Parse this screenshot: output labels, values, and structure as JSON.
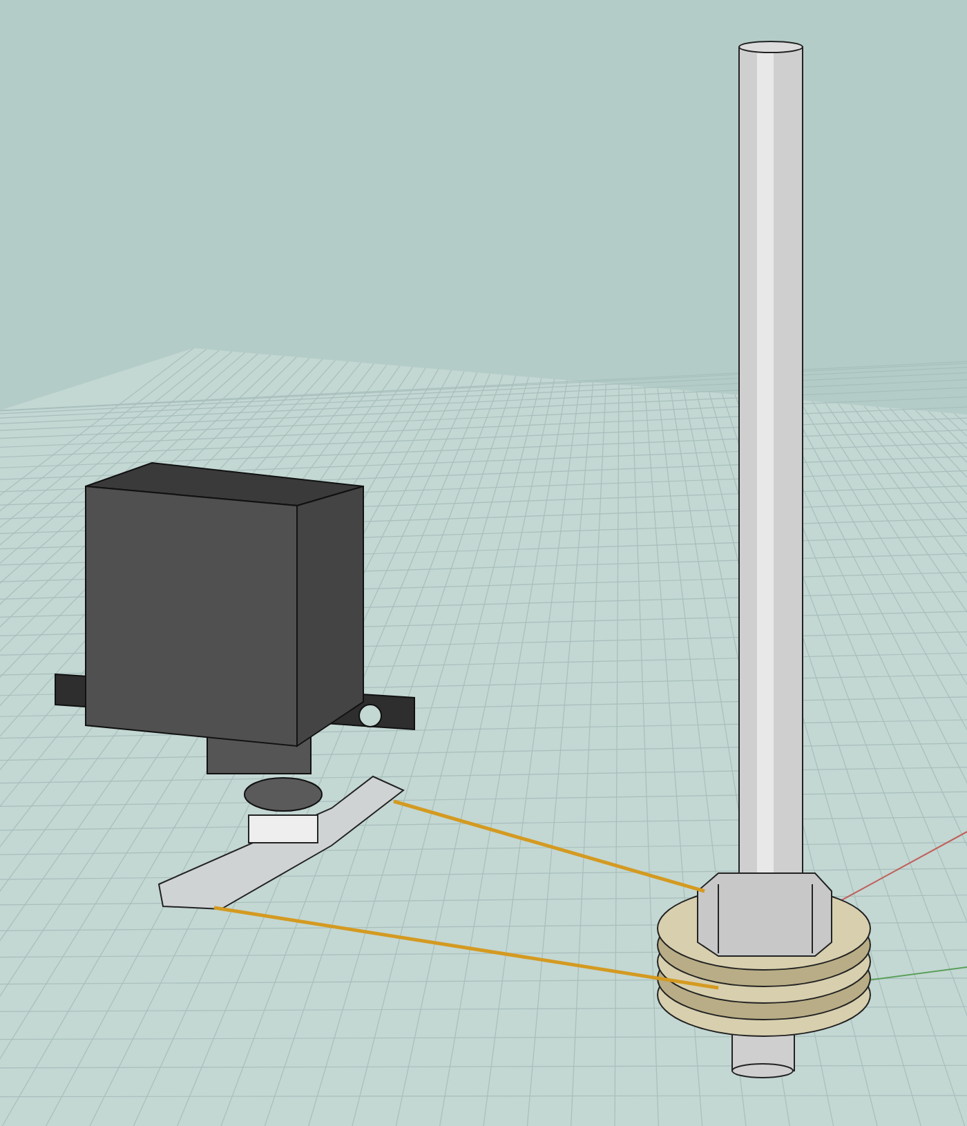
{
  "viewport": {
    "grid": {
      "visible": true
    },
    "axes": {
      "visible": true
    },
    "objects": [
      {
        "kind": "rod"
      },
      {
        "kind": "servo"
      },
      {
        "kind": "pulley"
      },
      {
        "kind": "belt"
      }
    ]
  }
}
